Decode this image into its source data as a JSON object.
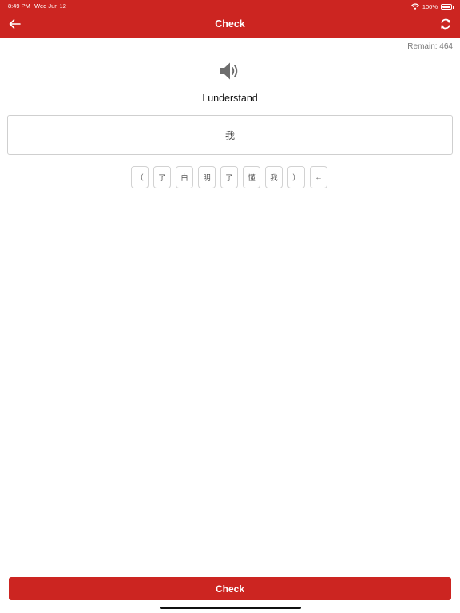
{
  "status_bar": {
    "time": "8:49 PM",
    "date": "Wed Jun 12",
    "battery": "100%"
  },
  "nav": {
    "title": "Check",
    "back_icon": "arrow-left-icon",
    "refresh_icon": "refresh-icon"
  },
  "remain": "Remain: 464",
  "prompt": "I understand",
  "answer": "我",
  "keys": [
    "（",
    "了",
    "白",
    "明",
    "了",
    "懂",
    "我",
    "）",
    "←"
  ],
  "check_button": "Check",
  "colors": {
    "accent": "#cc2521",
    "border": "#cfcfcf"
  }
}
